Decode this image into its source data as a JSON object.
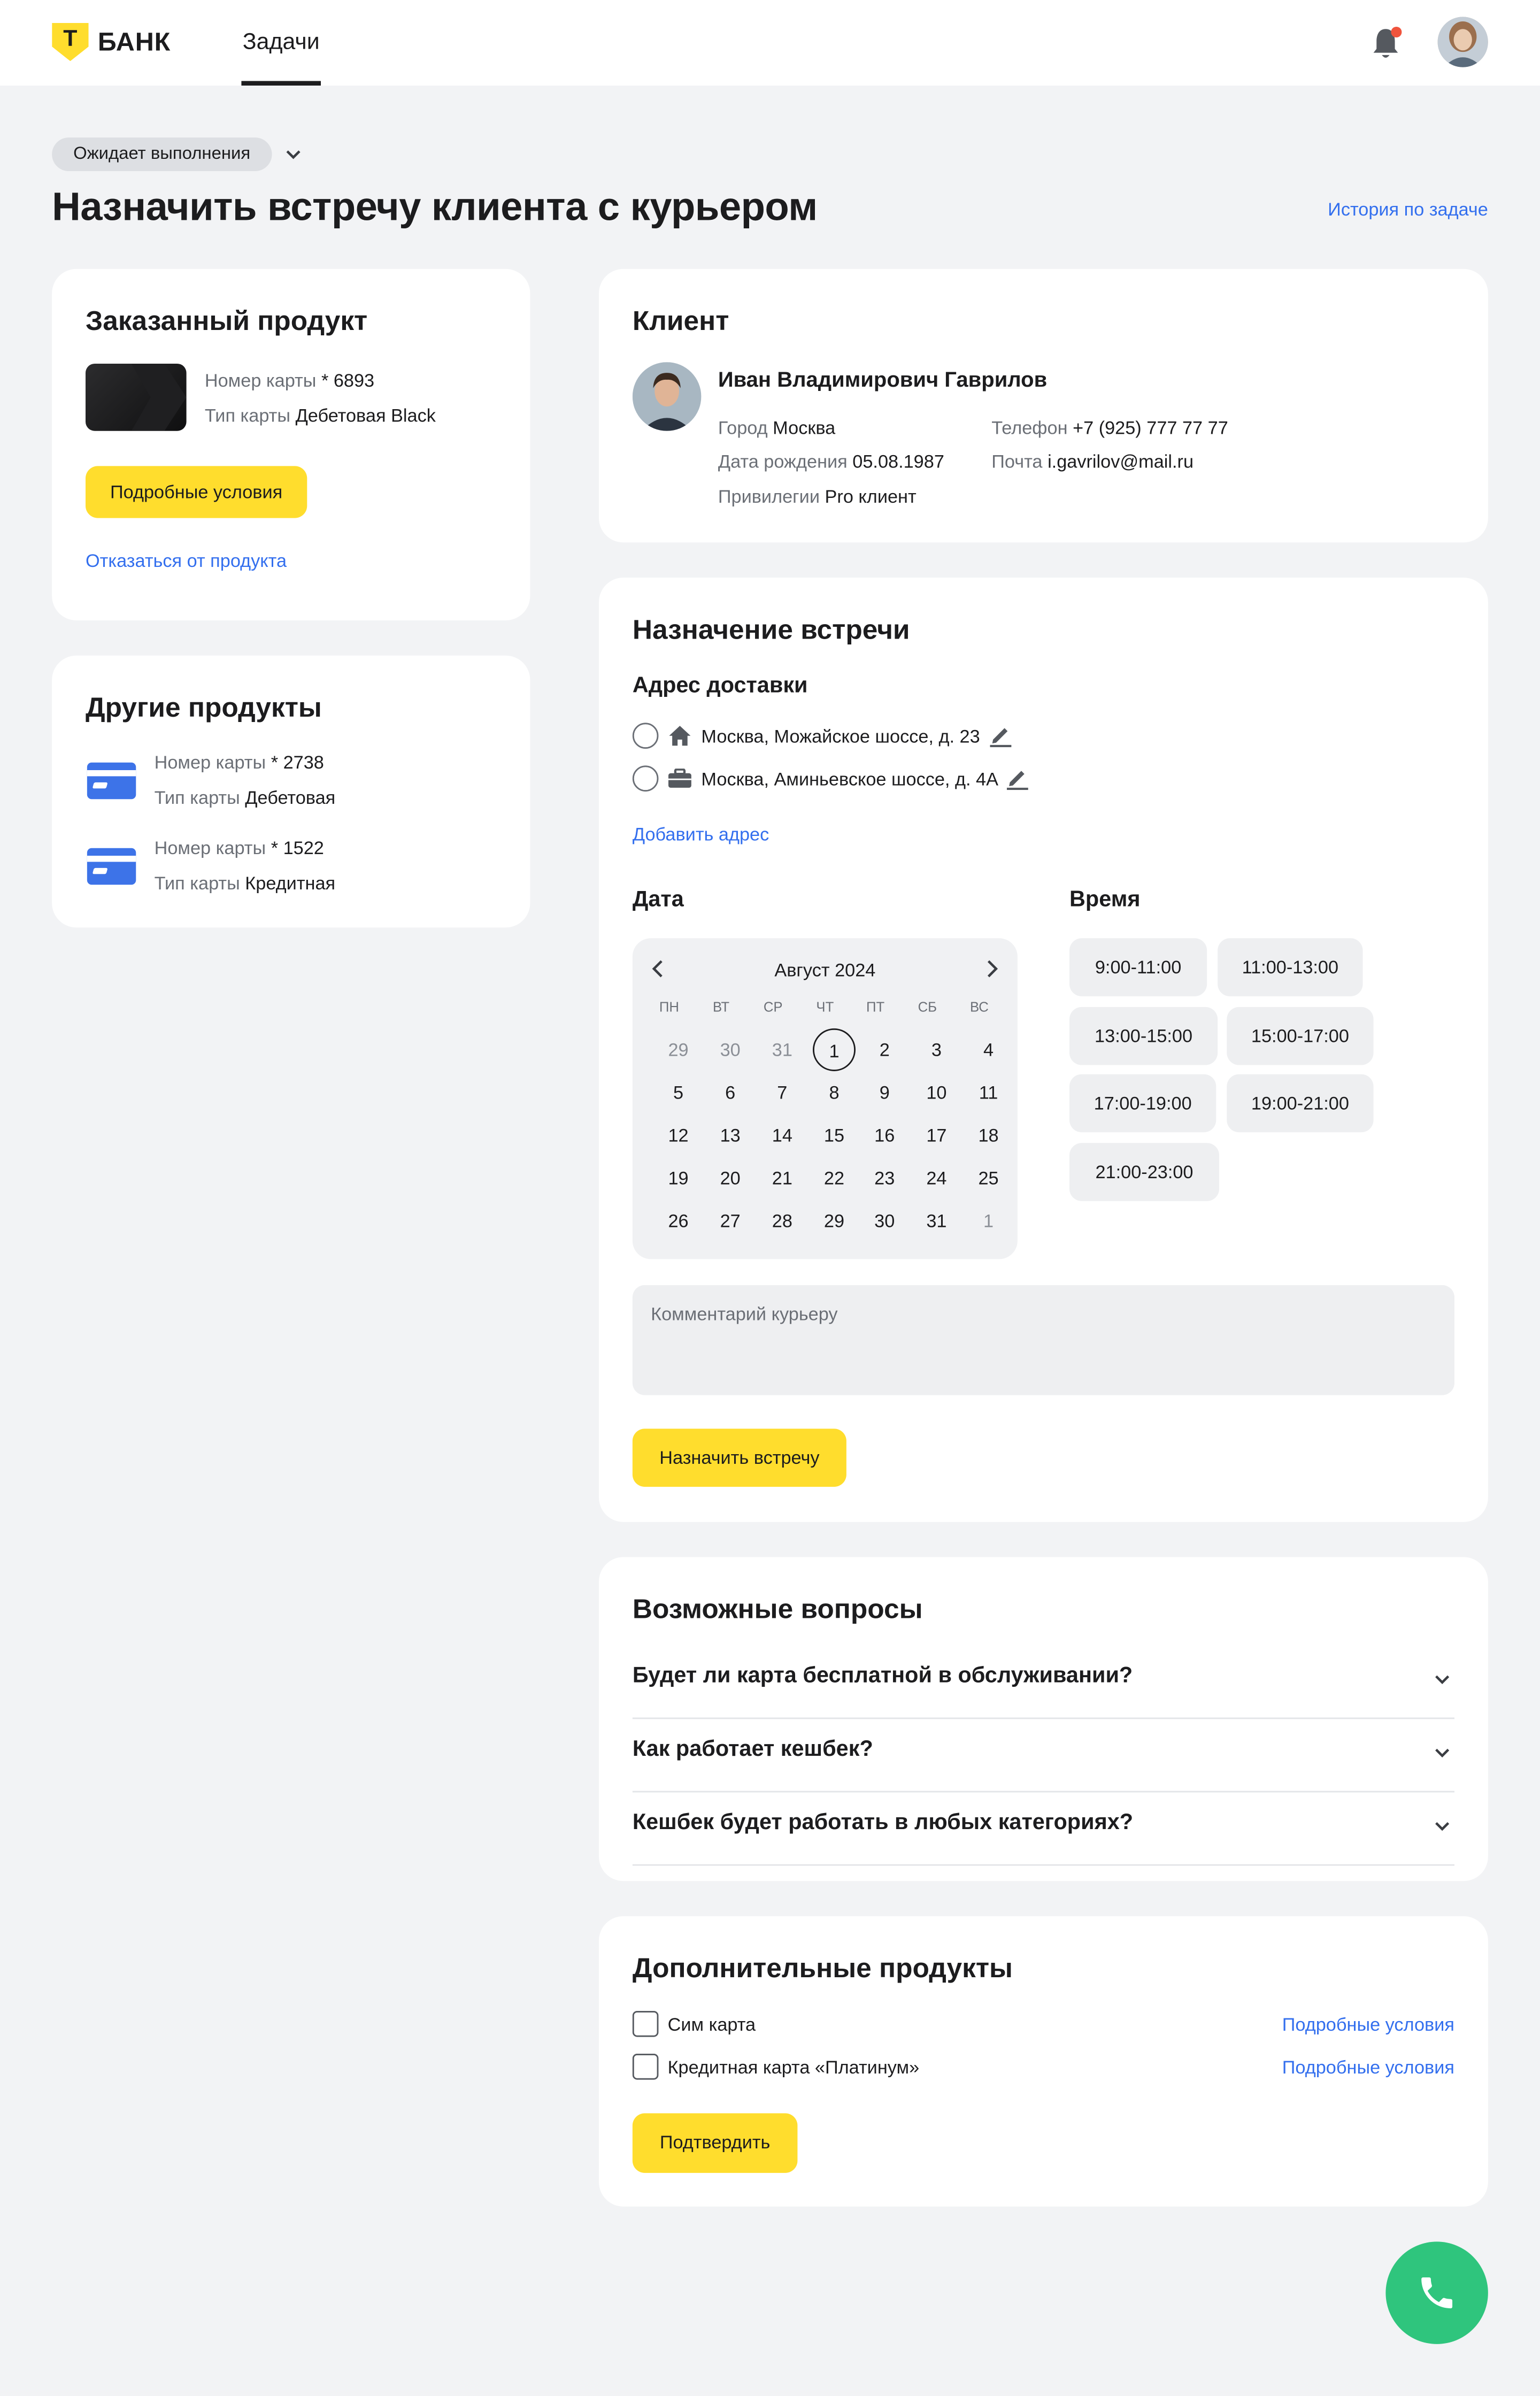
{
  "header": {
    "logo_letter": "Т",
    "logo_text": "БАНК",
    "nav_tab": "Задачи"
  },
  "task": {
    "status": "Ожидает выполнения",
    "title": "Назначить встречу клиента с курьером",
    "history_link": "История по задаче"
  },
  "ordered_product": {
    "title": "Заказанный продукт",
    "card_number_label": "Номер карты",
    "card_number": "* 6893",
    "card_type_label": "Тип карты",
    "card_type": "Дебетовая Black",
    "details_button": "Подробные условия",
    "decline_link": "Отказаться от продукта"
  },
  "other_products": {
    "title": "Другие продукты",
    "items": [
      {
        "number_label": "Номер карты",
        "number": "* 2738",
        "type_label": "Тип карты",
        "type": "Дебетовая"
      },
      {
        "number_label": "Номер карты",
        "number": "* 1522",
        "type_label": "Тип карты",
        "type": "Кредитная"
      }
    ]
  },
  "client": {
    "title": "Клиент",
    "name": "Иван Владимирович Гаврилов",
    "city_label": "Город",
    "city": "Москва",
    "birth_label": "Дата рождения",
    "birth": "05.08.1987",
    "priv_label": "Привилегии",
    "priv": "Pro клиент",
    "phone_label": "Телефон",
    "phone": "+7 (925) 777 77 77",
    "email_label": "Почта",
    "email": "i.gavrilov@mail.ru"
  },
  "meeting": {
    "title": "Назначение встречи",
    "address_title": "Адрес доставки",
    "addresses": [
      {
        "icon": "home-icon",
        "text": "Москва, Можайское шоссе, д. 23"
      },
      {
        "icon": "briefcase-icon",
        "text": "Москва, Аминьевское шоссе, д. 4А"
      }
    ],
    "add_address": "Добавить адрес",
    "date_title": "Дата",
    "time_title": "Время",
    "calendar": {
      "month": "Август 2024",
      "weekdays": [
        "ПН",
        "ВТ",
        "СР",
        "ЧТ",
        "ПТ",
        "СБ",
        "ВС"
      ],
      "weeks": [
        [
          "29",
          "30",
          "31",
          "1",
          "2",
          "3",
          "4"
        ],
        [
          "5",
          "6",
          "7",
          "8",
          "9",
          "10",
          "11"
        ],
        [
          "12",
          "13",
          "14",
          "15",
          "16",
          "17",
          "18"
        ],
        [
          "19",
          "20",
          "21",
          "22",
          "23",
          "24",
          "25"
        ],
        [
          "26",
          "27",
          "28",
          "29",
          "30",
          "31",
          "1"
        ]
      ],
      "selected": "1"
    },
    "slots": [
      "9:00-11:00",
      "11:00-13:00",
      "13:00-15:00",
      "15:00-17:00",
      "17:00-19:00",
      "19:00-21:00",
      "21:00-23:00"
    ],
    "comment_placeholder": "Комментарий курьеру",
    "submit": "Назначить встречу"
  },
  "faq": {
    "title": "Возможные вопросы",
    "items": [
      "Будет ли карта бесплатной в обслуживании?",
      "Как работает кешбек?",
      "Кешбек будет работать в любых категориях?"
    ]
  },
  "extra_products": {
    "title": "Дополнительные продукты",
    "items": [
      {
        "label": "Сим карта",
        "link": "Подробные условия"
      },
      {
        "label": "Кредитная карта «Платинум»",
        "link": "Подробные условия"
      }
    ],
    "confirm": "Подтвердить"
  },
  "colors": {
    "accent": "#ffdd2d",
    "link": "#336fee",
    "call": "#2fc57d",
    "background": "#f2f3f5"
  }
}
